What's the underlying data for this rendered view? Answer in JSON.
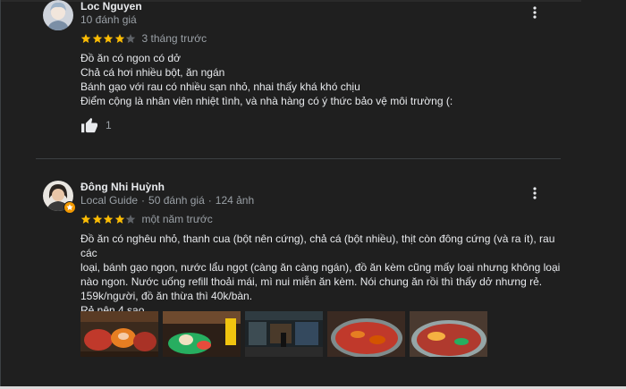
{
  "reviews": [
    {
      "name": "Loc Nguyen",
      "meta": "10 đánh giá",
      "rating": 4,
      "time": "3 tháng trước",
      "lines": [
        "Đồ ăn có ngon có dở",
        "Chả cá hơi nhiều bột, ăn ngán",
        "Bánh gạo với rau có nhiều sạn nhỏ, nhai thấy khá khó chịu",
        "Điểm cộng là nhân viên nhiệt tình, và nhà hàng có ý thức bảo vệ môi trường (:"
      ],
      "likes": "1"
    },
    {
      "name": "Đông Nhi Huỳnh",
      "meta_guide": "Local Guide",
      "meta_reviews": "50 đánh giá",
      "meta_photos": "124 ảnh",
      "rating": 4,
      "time": "một năm trước",
      "lines": [
        "Đồ ăn có nghêu nhỏ, thanh cua (bột nên cứng), chả cá (bột nhiều), thịt còn đông cứng (và ra ít), rau các",
        "loại, bánh gạo ngon, nước lẩu ngọt (càng ăn càng ngán), đồ ăn kèm cũng mấy loại nhưng không loại",
        "nào ngon. Nước uống refill thoải mái, mì nui miễn ăn kèm. Nói chung ăn rồi thì thấy dở nhưng rẻ.",
        "159k/người, đồ ăn thừa thì 40k/bàn.",
        "Rẻ nên 4 sao"
      ]
    }
  ],
  "colors": {
    "star": "#fbbc04",
    "star_empty": "#5f6368",
    "background": "#1f1f1f",
    "text": "#e8eaed",
    "secondary": "#9aa0a6"
  },
  "icons": {
    "more": "more-vert-icon",
    "like": "thumb-up-icon",
    "badge": "local-guide-badge-icon"
  }
}
